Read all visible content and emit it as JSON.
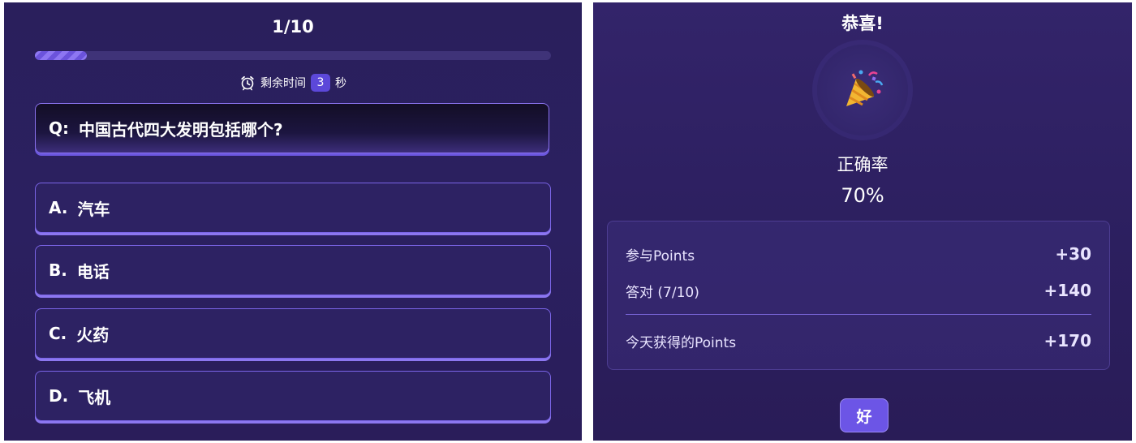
{
  "quiz": {
    "counter": "1/10",
    "progress_fraction": 0.1,
    "timer": {
      "label": "剩余时间",
      "seconds": "3",
      "unit": "秒",
      "icon": "alarm-clock-icon"
    },
    "question": {
      "prefix": "Q:",
      "text": "中国古代四大发明包括哪个?"
    },
    "options": [
      {
        "letter": "A.",
        "text": "汽车"
      },
      {
        "letter": "B.",
        "text": "电话"
      },
      {
        "letter": "C.",
        "text": "火药"
      },
      {
        "letter": "D.",
        "text": "飞机"
      }
    ]
  },
  "result": {
    "title": "恭喜!",
    "icon": "party-popper-icon",
    "accuracy_label": "正确率",
    "accuracy_value": "70%",
    "rows": [
      {
        "label": "参与Points",
        "value": "+30"
      },
      {
        "label": "答对 (7/10)",
        "value": "+140"
      }
    ],
    "total": {
      "label": "今天获得的Points",
      "value": "+170"
    },
    "ok_label": "好"
  },
  "colors": {
    "background": "#2b2060",
    "accent": "#6c55e6",
    "border": "#8b73f0",
    "text": "#ffffff"
  }
}
